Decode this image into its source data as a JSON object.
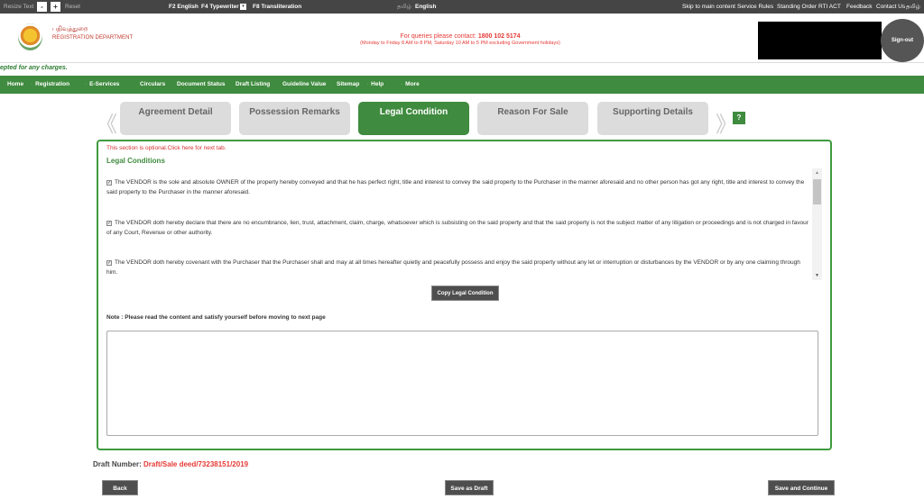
{
  "topbar": {
    "resize_text": "Resize Text",
    "minus": "-",
    "plus": "+",
    "reset": "Reset",
    "f2": "F2 English",
    "f4": "F4 Typewriter",
    "f4_dropdown": "▾",
    "f8": "F8 Transliteration",
    "lang_tamil": "தமிழ்",
    "lang_english": "English",
    "links": [
      "Skip to main content",
      "Service Rules",
      "Standing Order",
      "RTI ACT",
      "Feedback",
      "Contact Us"
    ],
    "lang_switch": "தமிழ்"
  },
  "header": {
    "dept_tamil": "பதிவுத்துறை",
    "dept_english": "REGISTRATION DEPARTMENT",
    "query_label": "For queries please contact: ",
    "query_phone": "1800 102 5174",
    "query_hours": "(Monday to Friday 8 AM to 8 PM, Saturday 10 AM to 5 PM excluding Government holidays)",
    "signout": "Sign-out"
  },
  "marquee": "epted for any charges.",
  "nav": {
    "items": [
      "Home",
      "Registration",
      "E-Services",
      "Circulars",
      "Document Status",
      "Draft Listing",
      "Guideline Value",
      "Sitemap",
      "Help",
      "More"
    ]
  },
  "tabs": [
    {
      "label": "Agreement Detail",
      "active": false
    },
    {
      "label": "Possession Remarks",
      "active": false
    },
    {
      "label": "Legal Condition",
      "active": true
    },
    {
      "label": "Reason For Sale",
      "active": false
    },
    {
      "label": "Supporting Details",
      "active": false
    }
  ],
  "tab_prev": "《",
  "tab_next": "》",
  "help": "?",
  "panel": {
    "optional_note": "This section is optional.Click here for next tab.",
    "title": "Legal Conditions",
    "conditions": [
      {
        "checked": true,
        "text": "The VENDOR is the sole and absolute OWNER of the property hereby conveyed and that he has perfect right, title and interest to convey the said property to the Purchaser in the manner aforesaid and no other person has got any right, title and interest to convey the said property to the Purchaser in the manner aforesaid."
      },
      {
        "checked": true,
        "text": "The VENDOR doth hereby declare that there are no encumbrance, lien, trust, attachment, claim, charge, whatsoever which is subsisting on the said property and that the said property is not the subject matter of any litigation or proceedings and is not charged in favour of any Court, Revenue or other authority."
      },
      {
        "checked": true,
        "text": "The VENDOR doth hereby covenant with the Purchaser that the Purchaser shall and may at all times hereafter quietly and peacefully possess and enjoy the said property without any let or interruption or disturbances by the VENDOR or by any one claiming through him."
      }
    ],
    "copy_button": "Copy Legal Condition",
    "note": "Note : Please read the content and satisfy yourself before moving to next page",
    "textarea_value": ""
  },
  "draft": {
    "label": "Draft Number: ",
    "value": "Draft/Sale deed/73238151/2019"
  },
  "buttons": {
    "back": "Back",
    "save_draft": "Save as Draft",
    "save_continue": "Save and Continue"
  },
  "colors": {
    "brand_green": "#3f8b3f",
    "alert_red": "#e53935",
    "dark_button": "#4e4e4e",
    "topbar": "#454545"
  }
}
